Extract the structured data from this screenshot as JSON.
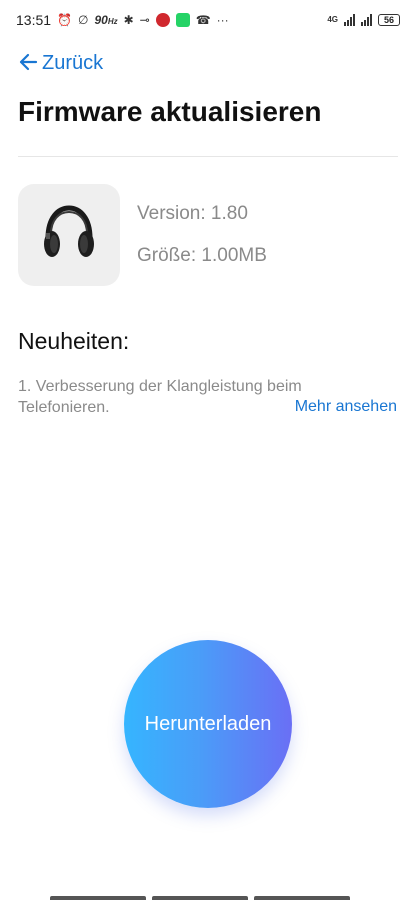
{
  "status_bar": {
    "time": "13:51",
    "refresh_rate": "90",
    "refresh_unit": "Hz",
    "network": "4G",
    "battery": "56"
  },
  "nav": {
    "back_label": "Zurück"
  },
  "page": {
    "title": "Firmware aktualisieren"
  },
  "firmware": {
    "version": "Version: 1.80",
    "size": "Größe: 1.00MB"
  },
  "news": {
    "heading": "Neuheiten:",
    "text": "1. Verbesserung der Klangleistung beim Telefonieren.",
    "more_label": "Mehr ansehen"
  },
  "action": {
    "download_label": "Herunterladen"
  },
  "colors": {
    "accent": "#1976d2",
    "button_gradient_start": "#35b5ff",
    "button_gradient_end": "#6a6ff5"
  },
  "icons": {
    "product": "headphones-icon"
  }
}
